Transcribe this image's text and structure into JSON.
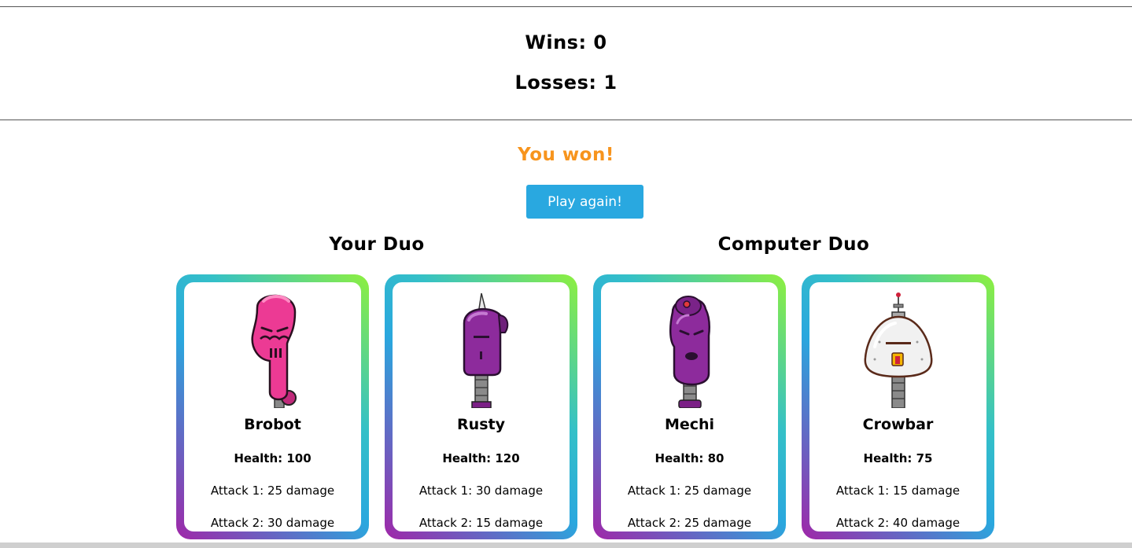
{
  "scoreboard": {
    "wins": "Wins: 0",
    "losses": "Losses: 1"
  },
  "result": {
    "message": "You won!",
    "color": "#f7941d"
  },
  "play_again_label": "Play again!",
  "colors": {
    "button": "#29a8e0",
    "card_gradient": [
      "#a026a8",
      "#2aa7de",
      "#8ef03e"
    ]
  },
  "your_duo": {
    "title": "Your Duo",
    "robots": [
      {
        "name": "Brobot",
        "health": "Health: 100",
        "attack1": "Attack 1: 25 damage",
        "attack2": "Attack 2: 30 damage",
        "icon": "pink-robot-icon"
      },
      {
        "name": "Rusty",
        "health": "Health: 120",
        "attack1": "Attack 1: 30 damage",
        "attack2": "Attack 2: 15 damage",
        "icon": "purple-horned-robot-icon"
      }
    ]
  },
  "computer_duo": {
    "title": "Computer Duo",
    "robots": [
      {
        "name": "Mechi",
        "health": "Health: 80",
        "attack1": "Attack 1: 25 damage",
        "attack2": "Attack 2: 25 damage",
        "icon": "purple-robot-icon"
      },
      {
        "name": "Crowbar",
        "health": "Health: 75",
        "attack1": "Attack 1: 15 damage",
        "attack2": "Attack 2: 40 damage",
        "icon": "white-antenna-robot-icon"
      }
    ]
  }
}
